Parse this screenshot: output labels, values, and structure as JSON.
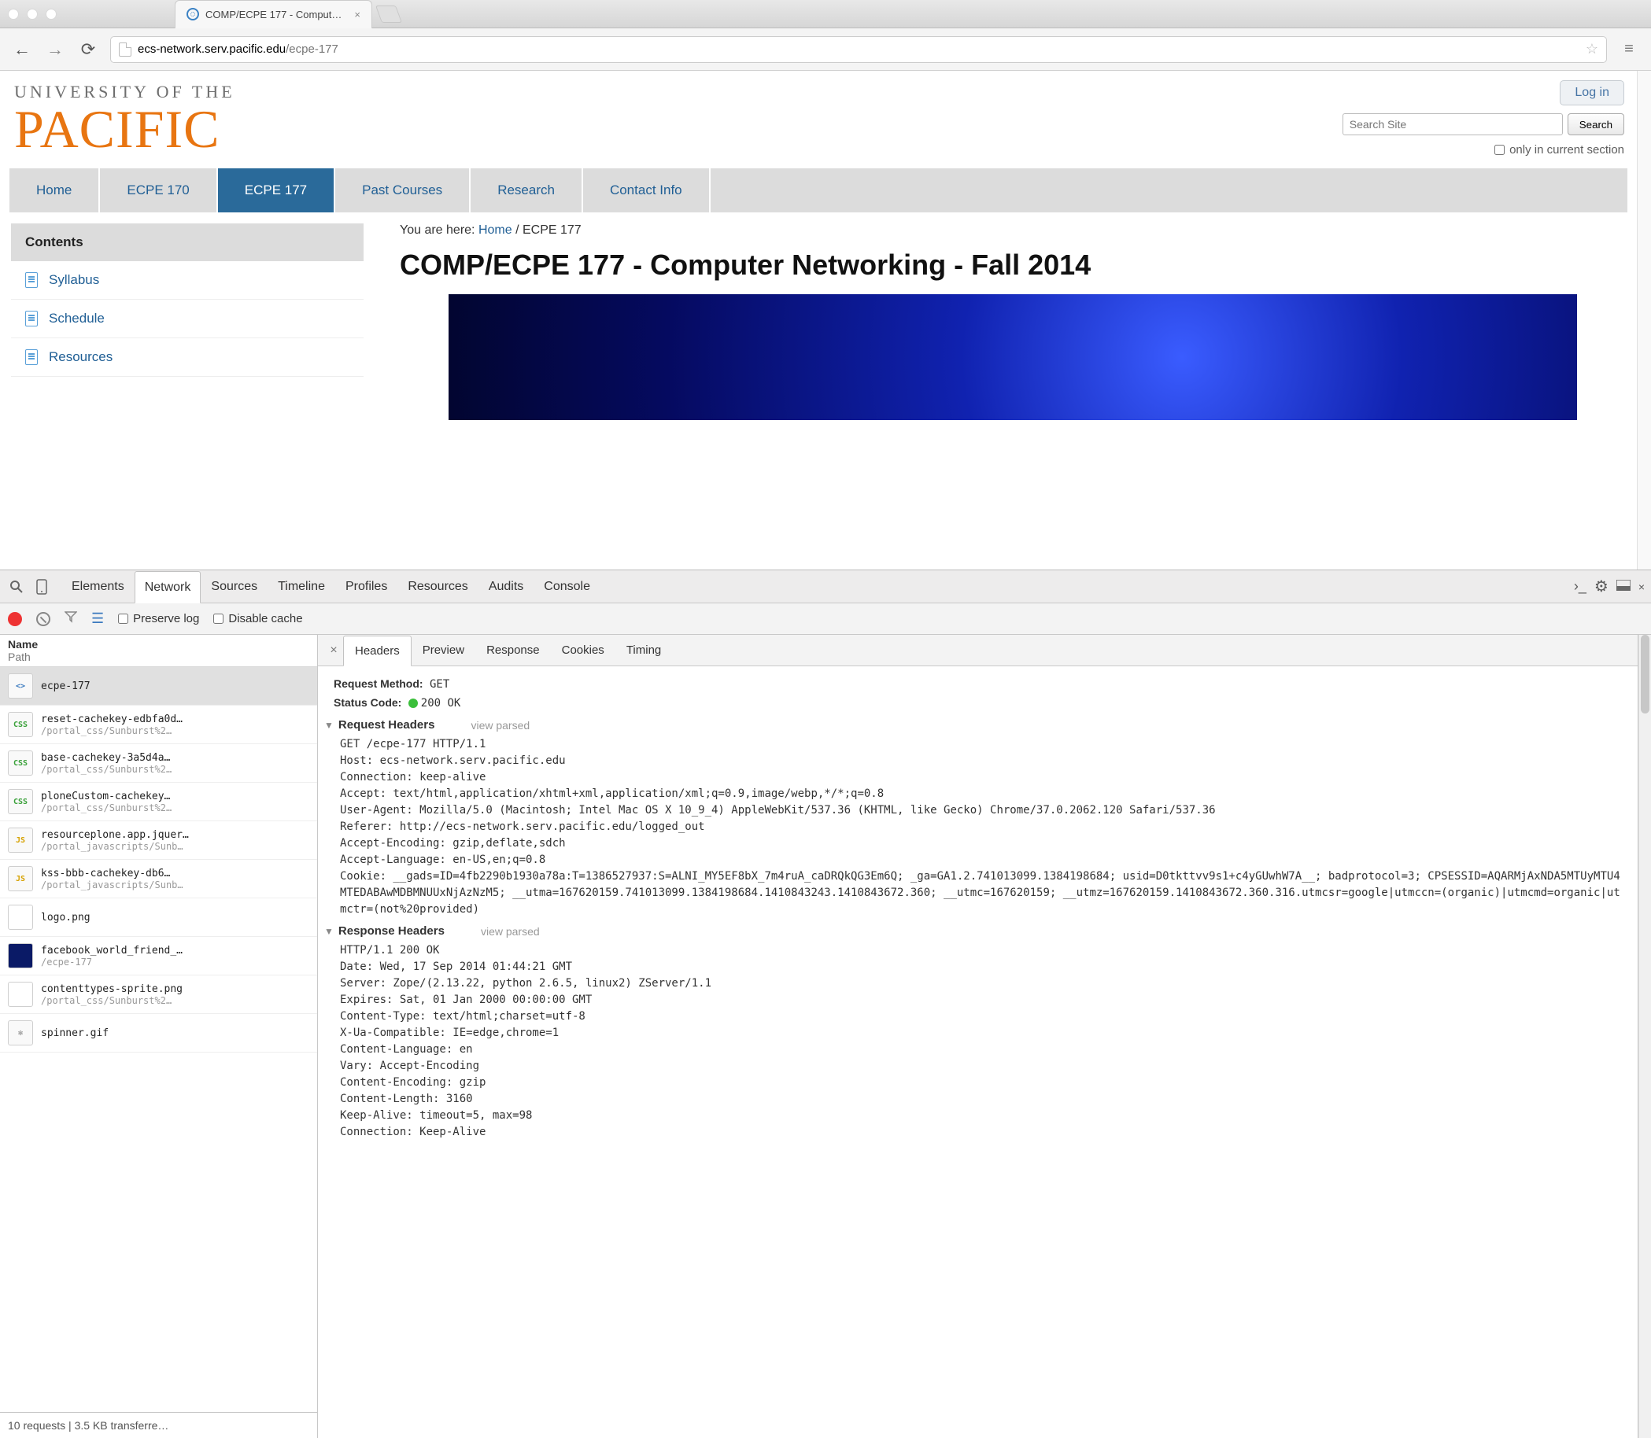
{
  "browser": {
    "tab_title": "COMP/ECPE 177 - Comput…",
    "url_host": "ecs-network.serv.pacific.edu",
    "url_path": "/ecpe-177"
  },
  "site": {
    "logo1": "UNIVERSITY OF THE",
    "logo2": "PACIFIC",
    "login": "Log in",
    "search_placeholder": "Search Site",
    "search_button": "Search",
    "only_label": "only in current section",
    "nav": [
      "Home",
      "ECPE 170",
      "ECPE 177",
      "Past Courses",
      "Research",
      "Contact Info"
    ],
    "nav_active_index": 2,
    "contents_title": "Contents",
    "contents_items": [
      "Syllabus",
      "Schedule",
      "Resources"
    ],
    "breadcrumb_prefix": "You are here: ",
    "breadcrumb_home": "Home",
    "breadcrumb_sep": " / ",
    "breadcrumb_current": "ECPE 177",
    "page_title": "COMP/ECPE 177 - Computer Networking - Fall 2014"
  },
  "devtools": {
    "main_tabs": [
      "Elements",
      "Network",
      "Sources",
      "Timeline",
      "Profiles",
      "Resources",
      "Audits",
      "Console"
    ],
    "main_active_index": 1,
    "preserve_log": "Preserve log",
    "disable_cache": "Disable cache",
    "list_head_name": "Name",
    "list_head_path": "Path",
    "requests": [
      {
        "name": "ecpe-177",
        "path": "",
        "icon": "<>",
        "color": "#3b7abf"
      },
      {
        "name": "reset-cachekey-edbfa0d…",
        "path": "/portal_css/Sunburst%2…",
        "icon": "CSS",
        "color": "#3aa13a"
      },
      {
        "name": "base-cachekey-3a5d4a…",
        "path": "/portal_css/Sunburst%2…",
        "icon": "CSS",
        "color": "#3aa13a"
      },
      {
        "name": "ploneCustom-cachekey…",
        "path": "/portal_css/Sunburst%2…",
        "icon": "CSS",
        "color": "#3aa13a"
      },
      {
        "name": "resourceplone.app.jquer…",
        "path": "/portal_javascripts/Sunb…",
        "icon": "JS",
        "color": "#d6a100"
      },
      {
        "name": "kss-bbb-cachekey-db6…",
        "path": "/portal_javascripts/Sunb…",
        "icon": "JS",
        "color": "#d6a100"
      },
      {
        "name": "logo.png",
        "path": "",
        "icon": "",
        "color": "#fff"
      },
      {
        "name": "facebook_world_friend_…",
        "path": "/ecpe-177",
        "icon": "",
        "color": "#0a1a66"
      },
      {
        "name": "contenttypes-sprite.png",
        "path": "/portal_css/Sunburst%2…",
        "icon": "",
        "color": "#fff"
      },
      {
        "name": "spinner.gif",
        "path": "",
        "icon": "✻",
        "color": "#888"
      }
    ],
    "selected_request_index": 0,
    "statusbar": "10 requests | 3.5 KB transferre…",
    "detail_tabs": [
      "Headers",
      "Preview",
      "Response",
      "Cookies",
      "Timing"
    ],
    "detail_active_index": 0,
    "summary": {
      "method_label": "Request Method:",
      "method_value": "GET",
      "status_label": "Status Code:",
      "status_value": "200 OK"
    },
    "req_head_label": "Request Headers",
    "resp_head_label": "Response Headers",
    "view_parsed": "view parsed",
    "request_raw": "GET /ecpe-177 HTTP/1.1\nHost: ecs-network.serv.pacific.edu\nConnection: keep-alive\nAccept: text/html,application/xhtml+xml,application/xml;q=0.9,image/webp,*/*;q=0.8\nUser-Agent: Mozilla/5.0 (Macintosh; Intel Mac OS X 10_9_4) AppleWebKit/537.36 (KHTML, like Gecko) Chrome/37.0.2062.120 Safari/537.36\nReferer: http://ecs-network.serv.pacific.edu/logged_out\nAccept-Encoding: gzip,deflate,sdch\nAccept-Language: en-US,en;q=0.8\nCookie: __gads=ID=4fb2290b1930a78a:T=1386527937:S=ALNI_MY5EF8bX_7m4ruA_caDRQkQG3Em6Q; _ga=GA1.2.741013099.1384198684; usid=D0tkttvv9s1+c4yGUwhW7A__; badprotocol=3; CPSESSID=AQARMjAxNDA5MTUyMTU4MTEDABAwMDBMNUUxNjAzNzM5; __utma=167620159.741013099.1384198684.1410843243.1410843672.360; __utmc=167620159; __utmz=167620159.1410843672.360.316.utmcsr=google|utmccn=(organic)|utmcmd=organic|utmctr=(not%20provided)",
    "response_raw": "HTTP/1.1 200 OK\nDate: Wed, 17 Sep 2014 01:44:21 GMT\nServer: Zope/(2.13.22, python 2.6.5, linux2) ZServer/1.1\nExpires: Sat, 01 Jan 2000 00:00:00 GMT\nContent-Type: text/html;charset=utf-8\nX-Ua-Compatible: IE=edge,chrome=1\nContent-Language: en\nVary: Accept-Encoding\nContent-Encoding: gzip\nContent-Length: 3160\nKeep-Alive: timeout=5, max=98\nConnection: Keep-Alive"
  }
}
